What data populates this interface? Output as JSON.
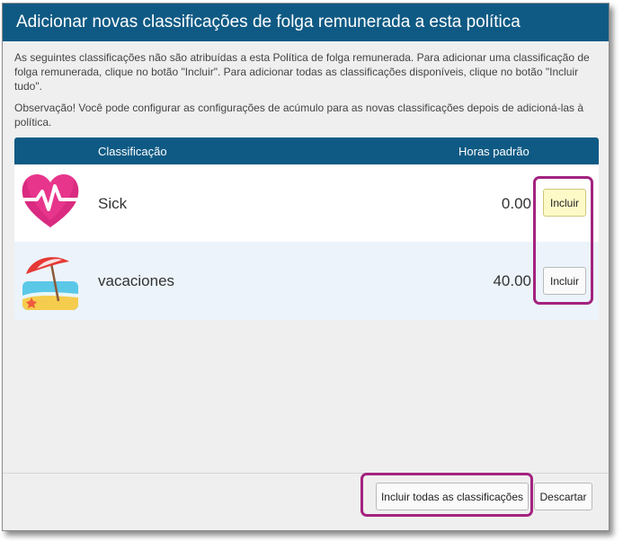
{
  "dialog": {
    "title": "Adicionar novas classificações de folga remunerada a esta política",
    "intro": "As seguintes classificações não são atribuídas a esta Política de folga remunerada. Para adicionar uma classificação de folga remunerada, clique no botão \"Incluir\". Para adicionar todas as classificações disponíveis, clique no botão \"Incluir tudo\".",
    "note": "Observação! Você pode configurar as configurações de acúmulo para as novas classificações depois de adicioná-las à política."
  },
  "table": {
    "headers": {
      "classification": "Classificação",
      "hours": "Horas padrão"
    },
    "rows": [
      {
        "name": "Sick",
        "hours": "0.00",
        "icon": "heart-pulse-icon",
        "button": "Incluir"
      },
      {
        "name": "vacaciones",
        "hours": "40.00",
        "icon": "beach-umbrella-icon",
        "button": "Incluir"
      }
    ]
  },
  "footer": {
    "include_all": "Incluir todas as classificações",
    "discard": "Descartar"
  },
  "colors": {
    "header": "#0f5a84",
    "highlight": "#a3237f",
    "heart": "#e8358c",
    "selected_button": "#fdfac8"
  }
}
